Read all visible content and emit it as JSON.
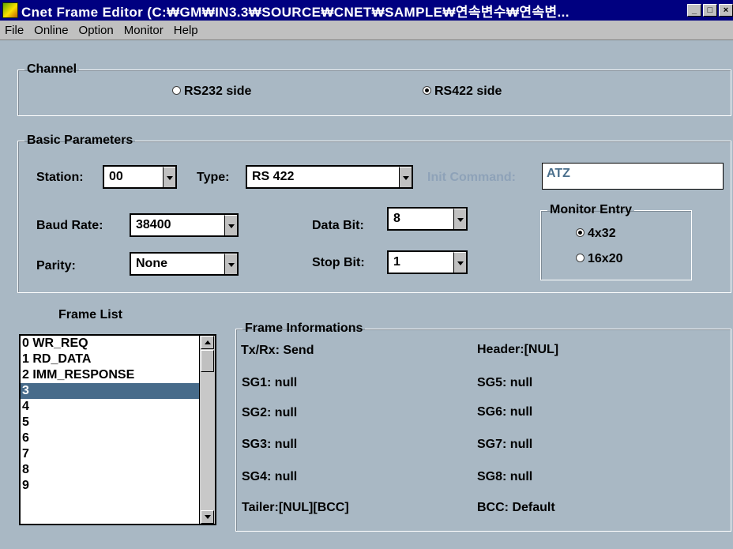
{
  "window": {
    "title": "Cnet Frame Editor (C:₩GM₩IN3.3₩SOURCE₩CNET₩SAMPLE₩연속변수₩연속변...",
    "minimize": "_",
    "maximize": "□",
    "close": "×"
  },
  "menu": [
    "File",
    "Online",
    "Option",
    "Monitor",
    "Help"
  ],
  "channel": {
    "legend": "Channel",
    "rs232": "RS232 side",
    "rs422": "RS422 side",
    "selected": "RS422 side"
  },
  "basic": {
    "legend": "Basic Parameters",
    "station_label": "Station:",
    "station_value": "00",
    "type_label": "Type:",
    "type_value": "RS 422",
    "init_label": "Init Command:",
    "init_value": "ATZ",
    "baud_label": "Baud Rate:",
    "baud_value": "38400",
    "databit_label": "Data Bit:",
    "databit_value": "8",
    "parity_label": "Parity:",
    "parity_value": "None",
    "stopbit_label": "Stop Bit:",
    "stopbit_value": "1",
    "monitor": {
      "legend": "Monitor Entry",
      "opt1": "4x32",
      "opt2": "16x20",
      "selected": "4x32"
    }
  },
  "frame_list": {
    "label": "Frame List",
    "items": [
      "0 WR_REQ",
      "1 RD_DATA",
      "2 IMM_RESPONSE",
      "3",
      "4",
      "5",
      "6",
      "7",
      "8",
      "9"
    ],
    "selected_index": 3
  },
  "frame_info": {
    "legend": "Frame Informations",
    "txrx": "Tx/Rx: Send",
    "header": "Header:[NUL]",
    "sg1": "SG1: null",
    "sg2": "SG2: null",
    "sg3": "SG3: null",
    "sg4": "SG4: null",
    "sg5": "SG5: null",
    "sg6": "SG6: null",
    "sg7": "SG7: null",
    "sg8": "SG8: null",
    "tailer": "Tailer:[NUL][BCC]",
    "bcc": "BCC: Default"
  }
}
